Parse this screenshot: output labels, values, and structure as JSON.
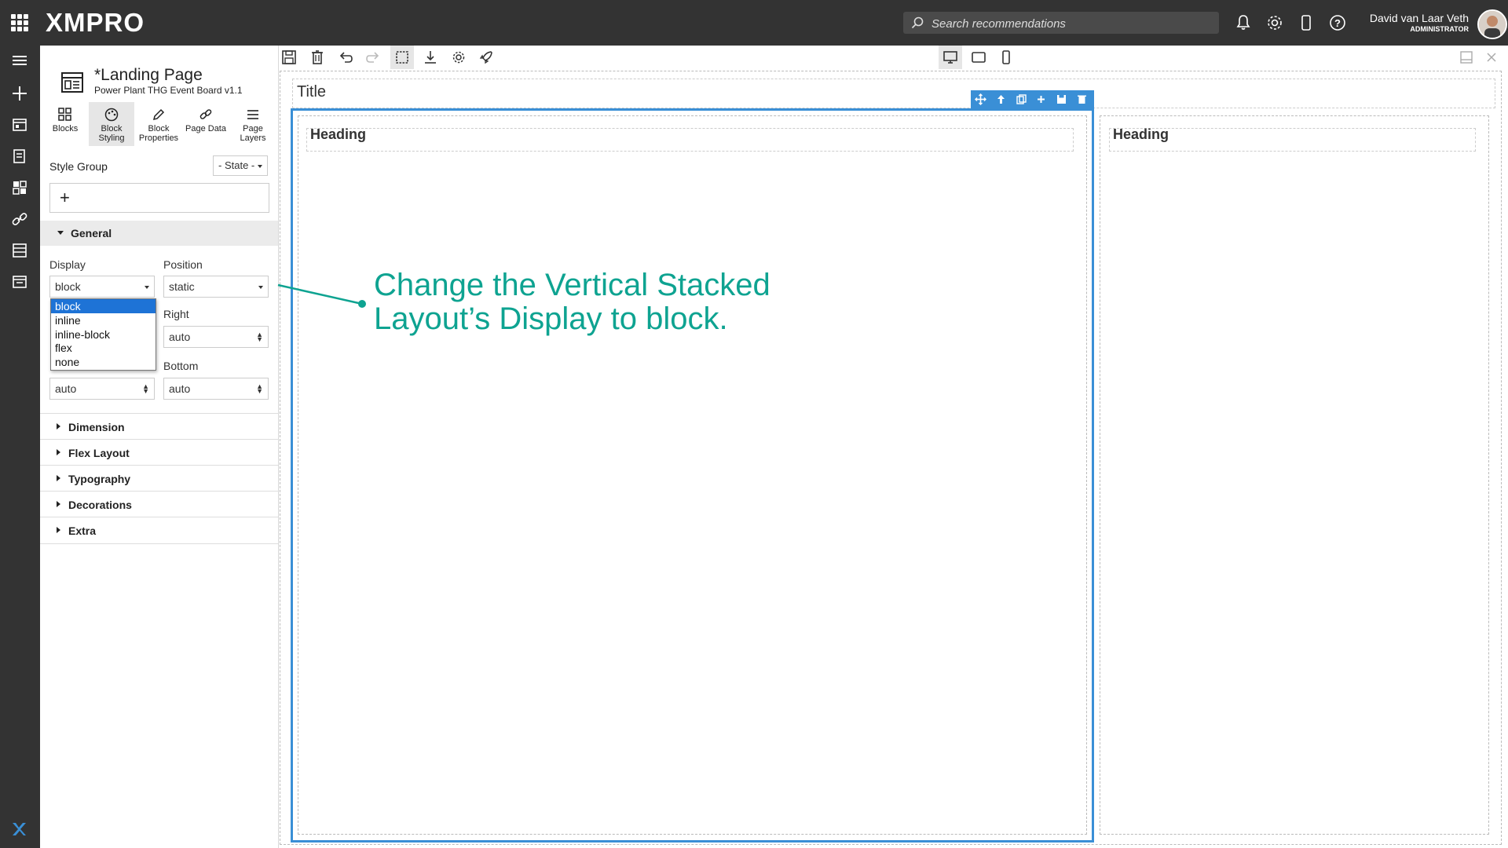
{
  "topbar": {
    "logo": "XMPRO",
    "search_placeholder": "Search recommendations",
    "user_name": "David van Laar Veth",
    "user_role": "ADMINISTRATOR"
  },
  "panel": {
    "page_title": "*Landing Page",
    "page_subtitle": "Power Plant THG Event Board v1.1",
    "tabs": [
      {
        "label_line1": "Blocks",
        "label_line2": ""
      },
      {
        "label_line1": "Block",
        "label_line2": "Styling"
      },
      {
        "label_line1": "Block",
        "label_line2": "Properties"
      },
      {
        "label_line1": "Page Data",
        "label_line2": ""
      },
      {
        "label_line1": "Page",
        "label_line2": "Layers"
      }
    ],
    "style_group_label": "Style Group",
    "state_select": "- State -",
    "add_symbol": "+",
    "general": {
      "title": "General",
      "display_label": "Display",
      "display_value": "block",
      "position_label": "Position",
      "position_value": "static",
      "right_label": "Right",
      "right_value": "auto",
      "bottom_label": "Bottom",
      "bottom_value": "auto",
      "left_value": "auto",
      "display_options": [
        "block",
        "inline",
        "inline-block",
        "flex",
        "none"
      ]
    },
    "sections": [
      "Dimension",
      "Flex Layout",
      "Typography",
      "Decorations",
      "Extra"
    ]
  },
  "canvas": {
    "title": "Title",
    "heading_1": "Heading",
    "heading_2": "Heading"
  },
  "annotation": {
    "line1": "Change the Vertical Stacked",
    "line2": "Layout’s Display to block."
  },
  "colors": {
    "topbar_bg": "#333333",
    "selection_blue": "#3a8fd6",
    "annotation_teal": "#0ea391",
    "dropdown_selected": "#1e73d6"
  }
}
